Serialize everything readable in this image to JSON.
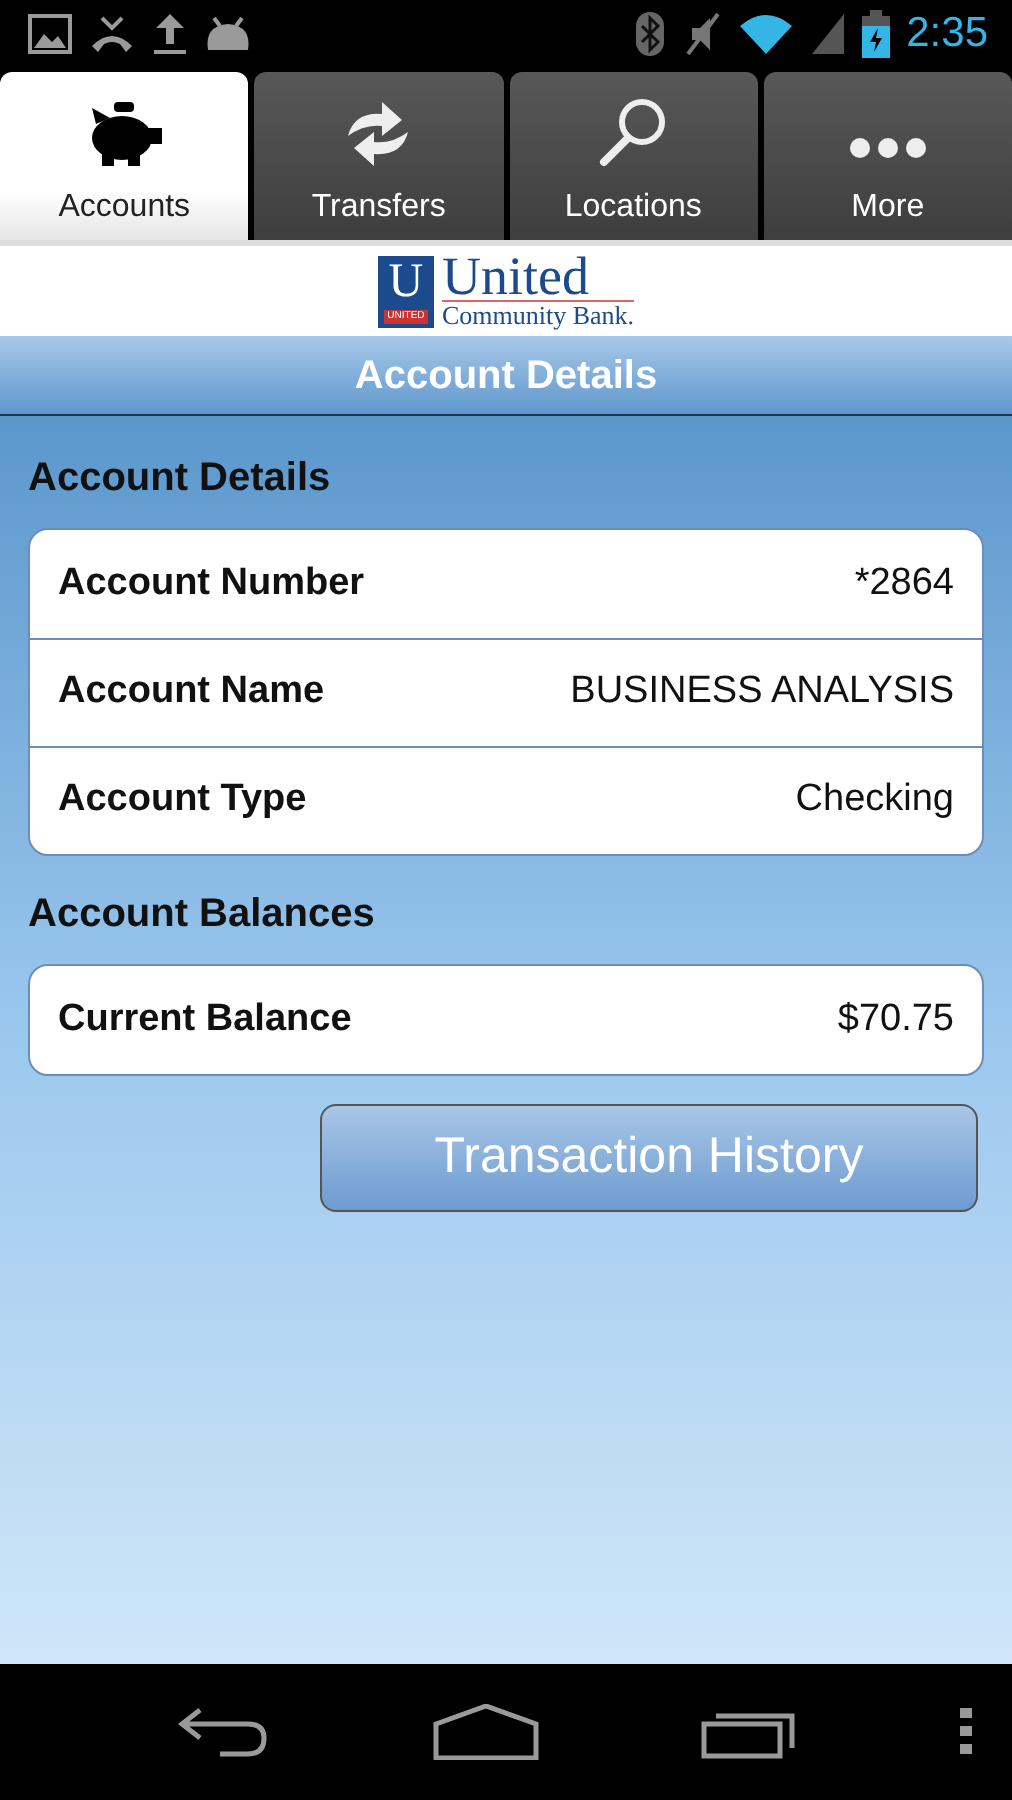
{
  "status_bar": {
    "time": "2:35"
  },
  "tabs": [
    {
      "label": "Accounts",
      "selected": true
    },
    {
      "label": "Transfers",
      "selected": false
    },
    {
      "label": "Locations",
      "selected": false
    },
    {
      "label": "More",
      "selected": false
    }
  ],
  "logo": {
    "mark": "U",
    "mark_caption": "UNITED",
    "name": "United",
    "subtitle": "Community Bank."
  },
  "header": {
    "title": "Account Details"
  },
  "sections": [
    {
      "title": "Account Details",
      "rows": [
        {
          "label": "Account Number",
          "value": "*2864"
        },
        {
          "label": "Account Name",
          "value": "BUSINESS ANALYSIS"
        },
        {
          "label": "Account Type",
          "value": "Checking"
        }
      ]
    },
    {
      "title": "Account Balances",
      "rows": [
        {
          "label": "Current Balance",
          "value": "$70.75"
        }
      ]
    }
  ],
  "action_button": {
    "label": "Transaction History"
  }
}
